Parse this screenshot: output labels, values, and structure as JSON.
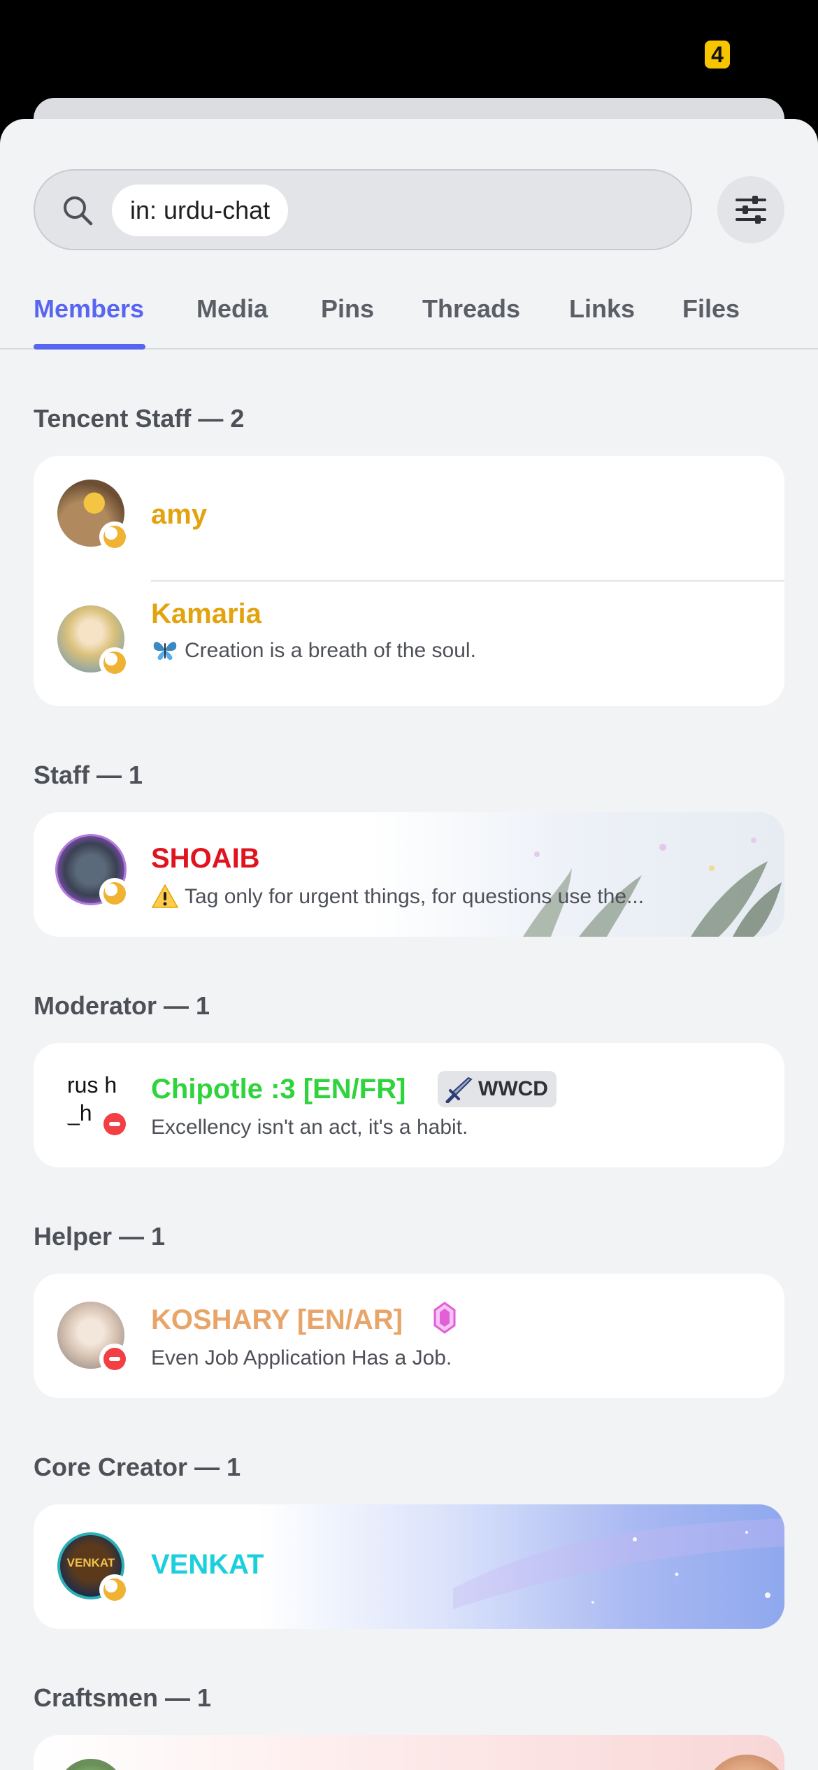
{
  "status_bar": {
    "battery": "4"
  },
  "search": {
    "chip_text": "in: urdu-chat"
  },
  "tabs": [
    {
      "label": "Members",
      "active": true
    },
    {
      "label": "Media",
      "active": false
    },
    {
      "label": "Pins",
      "active": false
    },
    {
      "label": "Threads",
      "active": false
    },
    {
      "label": "Links",
      "active": false
    },
    {
      "label": "Files",
      "active": false
    }
  ],
  "sections": [
    {
      "label": "Tencent Staff — 2",
      "members": [
        {
          "name": "amy",
          "bio": "",
          "status": "idle",
          "name_color": "#e3a30f"
        },
        {
          "name": "Kamaria",
          "bio": "Creation is a breath of the soul.",
          "bio_emoji": "butterfly",
          "status": "idle",
          "name_color": "#e3a30f"
        }
      ]
    },
    {
      "label": "Staff — 1",
      "members": [
        {
          "name": "SHOAIB",
          "bio": "Tag only for urgent things, for questions use the...",
          "bio_emoji": "warning",
          "status": "idle",
          "name_color": "#e0141e"
        }
      ]
    },
    {
      "label": "Moderator — 1",
      "members": [
        {
          "name": "Chipotle :3 [EN/FR]",
          "tag": "WWCD",
          "bio": "Excellency isn't an act, it's a habit.",
          "status": "dnd",
          "avatar_text": "rus h_h",
          "name_color": "#2fd33b"
        }
      ]
    },
    {
      "label": "Helper — 1",
      "members": [
        {
          "name": "KOSHARY [EN/AR]",
          "bio": "Even Job Application Has a Job.",
          "status": "dnd",
          "badge": "gem-icon",
          "name_color": "#e8a56a"
        }
      ]
    },
    {
      "label": "Core Creator — 1",
      "members": [
        {
          "name": "VENKAT",
          "bio": "",
          "status": "idle",
          "avatar_text": "VENKAT",
          "name_color": "#1ccfdc"
        }
      ]
    },
    {
      "label": "Craftsmen — 1",
      "members": []
    }
  ]
}
